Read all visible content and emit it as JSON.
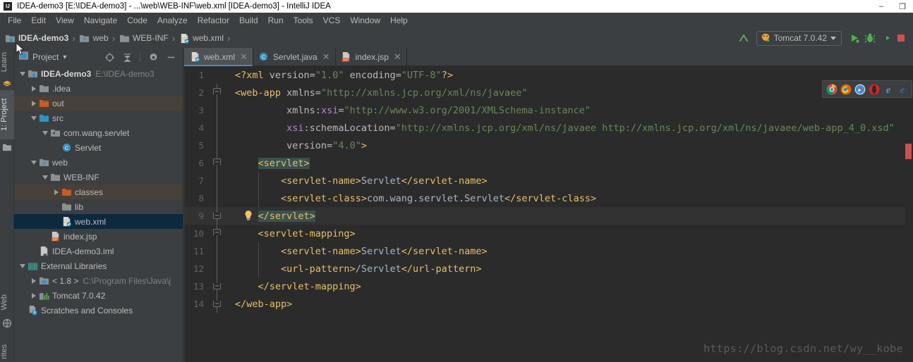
{
  "window": {
    "title": "IDEA-demo3 [E:\\IDEA-demo3] - ...\\web\\WEB-INF\\web.xml [IDEA-demo3] - IntelliJ IDEA",
    "app_icon": "intellij-idea-icon",
    "controls": {
      "minimize": "–",
      "maximize": "❐",
      "close": "✕"
    }
  },
  "menubar": {
    "items": [
      {
        "label": "File"
      },
      {
        "label": "Edit"
      },
      {
        "label": "View"
      },
      {
        "label": "Navigate"
      },
      {
        "label": "Code"
      },
      {
        "label": "Analyze"
      },
      {
        "label": "Refactor"
      },
      {
        "label": "Build"
      },
      {
        "label": "Run"
      },
      {
        "label": "Tools"
      },
      {
        "label": "VCS"
      },
      {
        "label": "Window"
      },
      {
        "label": "Help"
      }
    ]
  },
  "navbar": {
    "breadcrumbs": [
      {
        "label": "IDEA-demo3",
        "icon": "module-folder-icon"
      },
      {
        "label": "web",
        "icon": "web-folder-icon"
      },
      {
        "label": "WEB-INF",
        "icon": "folder-icon"
      },
      {
        "label": "web.xml",
        "icon": "xml-file-icon"
      }
    ],
    "separator": "›",
    "run_config": {
      "label": "Tomcat 7.0.42",
      "icon": "tomcat-icon"
    },
    "actions": [
      {
        "name": "update-application-button",
        "icon": "arrow-up-icon"
      },
      {
        "name": "run-button",
        "icon": "run-green-triangle-icon"
      },
      {
        "name": "debug-button",
        "icon": "debug-bug-icon"
      },
      {
        "name": "run-with-coverage-button",
        "icon": "coverage-icon"
      },
      {
        "name": "stop-button",
        "icon": "stop-square-icon"
      }
    ]
  },
  "rail": {
    "left_top": [
      {
        "label": "Learn",
        "active": false
      },
      {
        "label": "1: Project",
        "active": true
      }
    ],
    "left_bottom": [
      {
        "label": "Web",
        "active": false
      },
      {
        "label": "rites",
        "active": false
      }
    ]
  },
  "project_panel": {
    "title": "Project",
    "dropdown": "▾",
    "actions": [
      {
        "name": "locate-in-tree-button",
        "icon": "crosshair-icon"
      },
      {
        "name": "collapse-all-button",
        "icon": "collapse-all-icon"
      },
      {
        "name": "settings-button",
        "icon": "gear-icon"
      },
      {
        "name": "hide-button",
        "icon": "minus-icon"
      }
    ],
    "tree": [
      {
        "label": "IDEA-demo3",
        "sub": "E:\\IDEA-demo3",
        "indent": 0,
        "arrow": "down",
        "icon": "module-folder-icon",
        "bold": true,
        "state": ""
      },
      {
        "label": ".idea",
        "sub": "",
        "indent": 1,
        "arrow": "right",
        "icon": "folder-icon",
        "bold": false,
        "state": ""
      },
      {
        "label": "out",
        "sub": "",
        "indent": 1,
        "arrow": "right",
        "icon": "excluded-folder-icon",
        "bold": false,
        "state": "hl"
      },
      {
        "label": "src",
        "sub": "",
        "indent": 1,
        "arrow": "down",
        "icon": "source-folder-icon",
        "bold": false,
        "state": ""
      },
      {
        "label": "com.wang.servlet",
        "sub": "",
        "indent": 2,
        "arrow": "down",
        "icon": "package-icon",
        "bold": false,
        "state": ""
      },
      {
        "label": "Servlet",
        "sub": "",
        "indent": 3,
        "arrow": "none",
        "icon": "java-class-icon",
        "bold": false,
        "state": ""
      },
      {
        "label": "web",
        "sub": "",
        "indent": 1,
        "arrow": "down",
        "icon": "web-folder-icon",
        "bold": false,
        "state": ""
      },
      {
        "label": "WEB-INF",
        "sub": "",
        "indent": 2,
        "arrow": "down",
        "icon": "folder-icon",
        "bold": false,
        "state": ""
      },
      {
        "label": "classes",
        "sub": "",
        "indent": 3,
        "arrow": "right",
        "icon": "excluded-folder-icon",
        "bold": false,
        "state": "hl"
      },
      {
        "label": "lib",
        "sub": "",
        "indent": 3,
        "arrow": "none",
        "icon": "folder-icon",
        "bold": false,
        "state": ""
      },
      {
        "label": "web.xml",
        "sub": "",
        "indent": 3,
        "arrow": "none",
        "icon": "xml-file-icon",
        "bold": false,
        "state": "sel"
      },
      {
        "label": "index.jsp",
        "sub": "",
        "indent": 2,
        "arrow": "none",
        "icon": "jsp-file-icon",
        "bold": false,
        "state": ""
      },
      {
        "label": "IDEA-demo3.iml",
        "sub": "",
        "indent": 1,
        "arrow": "none",
        "icon": "iml-file-icon",
        "bold": false,
        "state": ""
      },
      {
        "label": "External Libraries",
        "sub": "",
        "indent": 0,
        "arrow": "down",
        "icon": "libraries-icon",
        "bold": false,
        "state": ""
      },
      {
        "label": "< 1.8 >",
        "sub": "C:\\Program Files\\Java\\j",
        "indent": 1,
        "arrow": "right",
        "icon": "jdk-icon",
        "bold": false,
        "state": ""
      },
      {
        "label": "Tomcat 7.0.42",
        "sub": "",
        "indent": 1,
        "arrow": "right",
        "icon": "tomcat-lib-icon",
        "bold": false,
        "state": ""
      },
      {
        "label": "Scratches and Consoles",
        "sub": "",
        "indent": 0,
        "arrow": "none",
        "icon": "scratches-icon",
        "bold": false,
        "state": ""
      }
    ]
  },
  "editor": {
    "tabs": [
      {
        "label": "web.xml",
        "icon": "xml-file-icon",
        "active": true,
        "close": "✕"
      },
      {
        "label": "Servlet.java",
        "icon": "java-class-icon",
        "active": false,
        "close": "✕"
      },
      {
        "label": "index.jsp",
        "icon": "jsp-file-icon",
        "active": false,
        "close": "✕"
      }
    ],
    "browsers": [
      {
        "name": "chrome-icon"
      },
      {
        "name": "firefox-icon"
      },
      {
        "name": "safari-icon"
      },
      {
        "name": "opera-icon"
      },
      {
        "name": "internet-explorer-icon"
      },
      {
        "name": "edge-icon"
      }
    ],
    "watermark": "https://blog.csdn.net/wy__kobe",
    "current_line": 9,
    "lines": [
      {
        "n": "1",
        "fold": "none",
        "bulb": false,
        "indent_guides": [],
        "tokens": [
          {
            "t": "<?xml ",
            "c": "pi"
          },
          {
            "t": "version",
            "c": "at"
          },
          {
            "t": "=",
            "c": "at"
          },
          {
            "t": "\"1.0\"",
            "c": "st"
          },
          {
            "t": " ",
            "c": "at"
          },
          {
            "t": "encoding",
            "c": "at"
          },
          {
            "t": "=",
            "c": "at"
          },
          {
            "t": "\"UTF-8\"",
            "c": "st"
          },
          {
            "t": "?>",
            "c": "pi"
          }
        ],
        "text": "<?xml version=\"1.0\" encoding=\"UTF-8\"?>"
      },
      {
        "n": "2",
        "fold": "start",
        "bulb": false,
        "indent_guides": [],
        "tokens": [
          {
            "t": "<web-app ",
            "c": "tg"
          },
          {
            "t": "xmlns",
            "c": "at"
          },
          {
            "t": "=",
            "c": "at"
          },
          {
            "t": "\"http://xmlns.jcp.org/xml/ns/javaee\"",
            "c": "st"
          }
        ],
        "text": "<web-app xmlns=\"http://xmlns.jcp.org/xml/ns/javaee\""
      },
      {
        "n": "3",
        "fold": "line",
        "bulb": false,
        "indent_guides": [],
        "tokens": [
          {
            "t": "         ",
            "c": "at"
          },
          {
            "t": "xmlns:",
            "c": "at"
          },
          {
            "t": "xsi",
            "c": "ns"
          },
          {
            "t": "=",
            "c": "at"
          },
          {
            "t": "\"http://www.w3.org/2001/XMLSchema-instance\"",
            "c": "st"
          }
        ],
        "text": "         xmlns:xsi=\"http://www.w3.org/2001/XMLSchema-instance\""
      },
      {
        "n": "4",
        "fold": "line",
        "bulb": false,
        "indent_guides": [],
        "tokens": [
          {
            "t": "         ",
            "c": "at"
          },
          {
            "t": "xsi",
            "c": "ns"
          },
          {
            "t": ":schemaLocation",
            "c": "at"
          },
          {
            "t": "=",
            "c": "at"
          },
          {
            "t": "\"http://xmlns.jcp.org/xml/ns/javaee http://xmlns.jcp.org/xml/ns/javaee/web-app_4_0.xsd\"",
            "c": "st"
          }
        ],
        "text": "         xsi:schemaLocation=\"http://xmlns.jcp.org/xml/ns/javaee http://xmlns.jcp.org/xml/ns/javaee/web-app_4_0.xsd\""
      },
      {
        "n": "5",
        "fold": "line",
        "bulb": false,
        "indent_guides": [],
        "tokens": [
          {
            "t": "         ",
            "c": "at"
          },
          {
            "t": "version",
            "c": "at"
          },
          {
            "t": "=",
            "c": "at"
          },
          {
            "t": "\"4.0\"",
            "c": "st"
          },
          {
            "t": ">",
            "c": "tg"
          }
        ],
        "text": "         version=\"4.0\">"
      },
      {
        "n": "6",
        "fold": "start",
        "bulb": false,
        "indent_guides": [],
        "tokens": [
          {
            "t": "    ",
            "c": "at"
          },
          {
            "t": "<servlet>",
            "c": "tg hl-brace"
          }
        ],
        "text": "    <servlet>"
      },
      {
        "n": "7",
        "fold": "line",
        "bulb": false,
        "indent_guides": [
          1
        ],
        "tokens": [
          {
            "t": "        ",
            "c": "at"
          },
          {
            "t": "<servlet-name>",
            "c": "tg"
          },
          {
            "t": "Servlet",
            "c": "txt"
          },
          {
            "t": "</servlet-name>",
            "c": "tg"
          }
        ],
        "text": "        <servlet-name>Servlet</servlet-name>"
      },
      {
        "n": "8",
        "fold": "line",
        "bulb": false,
        "indent_guides": [
          1
        ],
        "tokens": [
          {
            "t": "        ",
            "c": "at"
          },
          {
            "t": "<servlet-class>",
            "c": "tg"
          },
          {
            "t": "com.wang.servlet.Servlet",
            "c": "txt"
          },
          {
            "t": "</servlet-class>",
            "c": "tg"
          }
        ],
        "text": "        <servlet-class>com.wang.servlet.Servlet</servlet-class>"
      },
      {
        "n": "9",
        "fold": "end",
        "bulb": true,
        "indent_guides": [],
        "tokens": [
          {
            "t": "    ",
            "c": "at"
          },
          {
            "t": "</servlet>",
            "c": "tg hl-brace"
          }
        ],
        "text": "    </servlet>"
      },
      {
        "n": "10",
        "fold": "start",
        "bulb": false,
        "indent_guides": [],
        "tokens": [
          {
            "t": "    ",
            "c": "at"
          },
          {
            "t": "<servlet-mapping>",
            "c": "tg"
          }
        ],
        "text": "    <servlet-mapping>"
      },
      {
        "n": "11",
        "fold": "line",
        "bulb": false,
        "indent_guides": [
          1
        ],
        "tokens": [
          {
            "t": "        ",
            "c": "at"
          },
          {
            "t": "<servlet-name>",
            "c": "tg"
          },
          {
            "t": "Servlet",
            "c": "txt"
          },
          {
            "t": "</servlet-name>",
            "c": "tg"
          }
        ],
        "text": "        <servlet-name>Servlet</servlet-name>"
      },
      {
        "n": "12",
        "fold": "line",
        "bulb": false,
        "indent_guides": [
          1
        ],
        "tokens": [
          {
            "t": "        ",
            "c": "at"
          },
          {
            "t": "<url-pattern>",
            "c": "tg"
          },
          {
            "t": "/Servlet",
            "c": "txt"
          },
          {
            "t": "</url-pattern>",
            "c": "tg"
          }
        ],
        "text": "        <url-pattern>/Servlet</url-pattern>"
      },
      {
        "n": "13",
        "fold": "end",
        "bulb": false,
        "indent_guides": [],
        "tokens": [
          {
            "t": "    ",
            "c": "at"
          },
          {
            "t": "</servlet-mapping>",
            "c": "tg"
          }
        ],
        "text": "    </servlet-mapping>"
      },
      {
        "n": "14",
        "fold": "end",
        "bulb": false,
        "indent_guides": [],
        "tokens": [
          {
            "t": "</web-app>",
            "c": "tg"
          }
        ],
        "text": "</web-app>"
      }
    ]
  },
  "colors": {
    "chrome_bg": "#3c3f41",
    "editor_bg": "#2b2b2b",
    "selection": "#0d293e",
    "highlight_row": "#474139",
    "tag": "#e8bf6a",
    "string": "#6a8759",
    "text_value": "#a9b7c6",
    "namespace": "#b389c5",
    "accent": "#4a88c7",
    "error_marker": "#c75450"
  }
}
